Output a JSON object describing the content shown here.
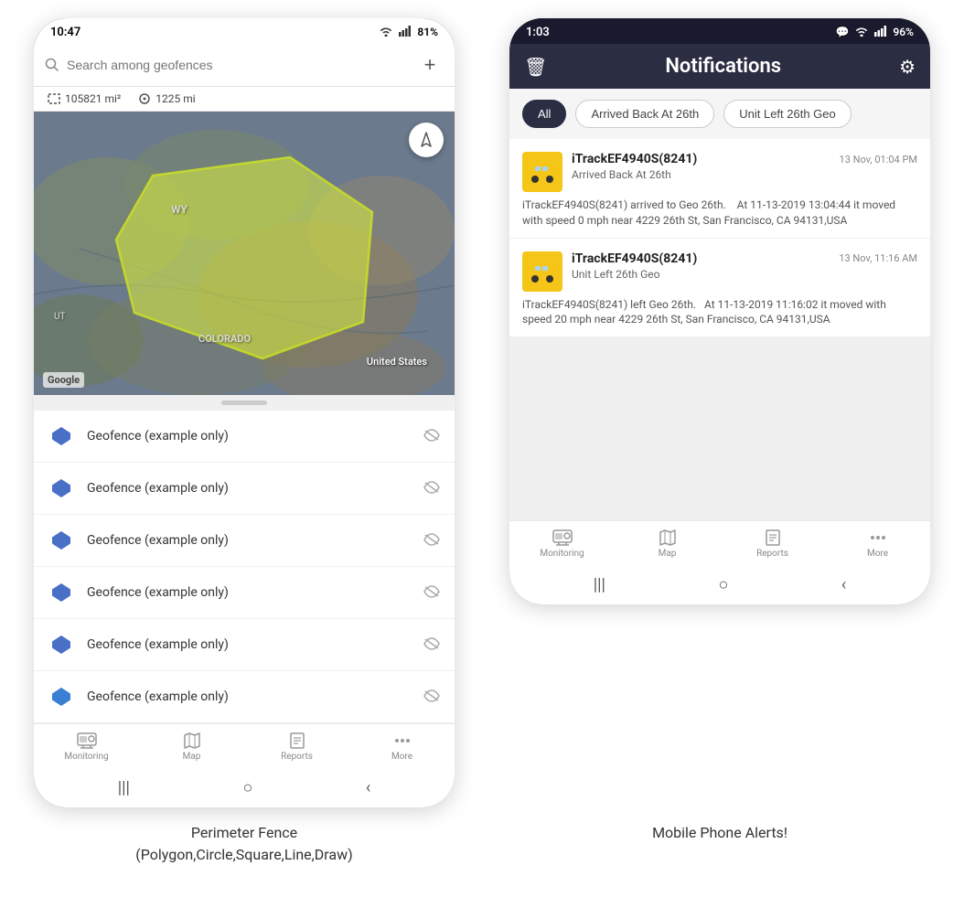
{
  "left_phone": {
    "status_bar": {
      "time": "10:47",
      "wifi": "WiFi",
      "signal": "Signal",
      "battery": "81%"
    },
    "search": {
      "placeholder": "Search among geofences",
      "add_button": "+"
    },
    "stats": {
      "area": "105821 mi²",
      "distance": "1225 mi"
    },
    "map": {
      "state_label": "WY",
      "region_label": "United States",
      "state_bottom": "COLORADO",
      "ut_label": "UT",
      "google_label": "Google"
    },
    "geofences": [
      {
        "name": "Geofence (example only)"
      },
      {
        "name": "Geofence (example only)"
      },
      {
        "name": "Geofence (example only)"
      },
      {
        "name": "Geofence (example only)"
      },
      {
        "name": "Geofence (example only)"
      },
      {
        "name": "Geofence (example only)"
      }
    ],
    "bottom_nav": [
      {
        "label": "Monitoring",
        "icon": "🚌"
      },
      {
        "label": "Map",
        "icon": "🗺"
      },
      {
        "label": "Reports",
        "icon": "📊"
      },
      {
        "label": "More",
        "icon": "···"
      }
    ]
  },
  "right_phone": {
    "status_bar": {
      "time": "1:03",
      "chat": "💬",
      "wifi": "WiFi",
      "signal": "Signal",
      "battery": "96%"
    },
    "header": {
      "title": "Notifications",
      "delete_icon": "🗑",
      "settings_icon": "⚙"
    },
    "filter_tabs": [
      {
        "label": "All",
        "active": true
      },
      {
        "label": "Arrived Back At 26th",
        "active": false
      },
      {
        "label": "Unit Left 26th Geo",
        "active": false
      }
    ],
    "notifications": [
      {
        "device": "iTrackEF4940S(8241)",
        "time": "13 Nov, 01:04 PM",
        "subtitle": "Arrived Back At 26th",
        "body": "iTrackEF4940S(8241) arrived to Geo 26th.    At 11-13-2019 13:04:44 it moved with speed 0 mph near 4229 26th St, San Francisco, CA 94131,USA"
      },
      {
        "device": "iTrackEF4940S(8241)",
        "time": "13 Nov, 11:16 AM",
        "subtitle": "Unit Left 26th Geo",
        "body": "iTrackEF4940S(8241) left Geo 26th.   At 11-13-2019 11:16:02 it moved with speed 20 mph near 4229 26th St, San Francisco, CA 94131,USA"
      }
    ],
    "bottom_nav": [
      {
        "label": "Monitoring",
        "icon": "🚌"
      },
      {
        "label": "Map",
        "icon": "🗺"
      },
      {
        "label": "Reports",
        "icon": "📊"
      },
      {
        "label": "More",
        "icon": "···"
      }
    ]
  },
  "captions": {
    "left": "Perimeter Fence\n(Polygon,Circle,Square,Line,Draw)",
    "right": "Mobile Phone Alerts!"
  }
}
